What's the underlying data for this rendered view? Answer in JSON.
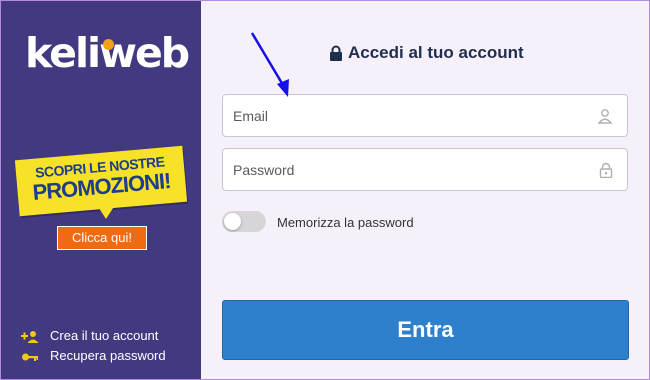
{
  "sidebar": {
    "logo": "keliweb",
    "promo": {
      "line1": "SCOPRI LE NOSTRE",
      "line2": "PROMOZIONI!",
      "cta": "Clicca qui!"
    },
    "links": [
      {
        "label": "Crea il tuo account",
        "icon": "add-user-icon"
      },
      {
        "label": "Recupera password",
        "icon": "key-icon"
      }
    ],
    "colors": {
      "background": "#423a80",
      "promo": "#f7e227",
      "cta": "#f06a12",
      "logo_dot": "#f5a01a"
    }
  },
  "login": {
    "title": "Accedi al tuo account",
    "email_placeholder": "Email",
    "password_placeholder": "Password",
    "remember_label": "Memorizza la password",
    "submit_label": "Entra",
    "colors": {
      "button": "#2f80cc",
      "annotation_arrow": "#1410e6"
    }
  }
}
